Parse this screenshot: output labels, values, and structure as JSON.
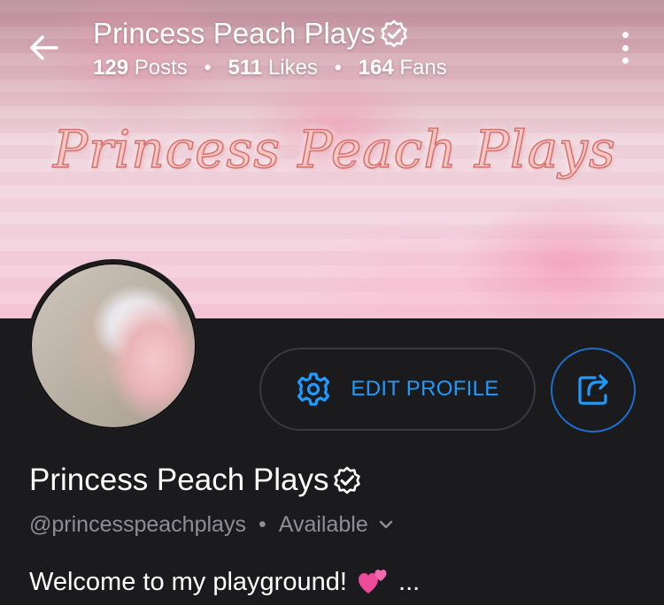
{
  "header": {
    "title": "Princess Peach Plays",
    "stats": [
      {
        "value": "129",
        "label": "Posts"
      },
      {
        "value": "511",
        "label": "Likes"
      },
      {
        "value": "164",
        "label": "Fans"
      }
    ],
    "separator": "•"
  },
  "banner": {
    "script_text": "Princess Peach Plays"
  },
  "actions": {
    "edit_profile_label": "EDIT PROFILE"
  },
  "profile": {
    "name": "Princess Peach Plays",
    "handle": "@princesspeachplays",
    "separator": "•",
    "status": "Available",
    "bio": "Welcome to my playground!",
    "bio_suffix": "..."
  },
  "colors": {
    "accent": "#1f9bff",
    "background": "#1b1b1d",
    "muted_text": "#8e8e93"
  },
  "icons": [
    "back-arrow-icon",
    "verified-badge-icon",
    "more-vertical-icon",
    "gear-icon",
    "share-icon",
    "chevron-down-icon",
    "two-hearts-emoji"
  ]
}
